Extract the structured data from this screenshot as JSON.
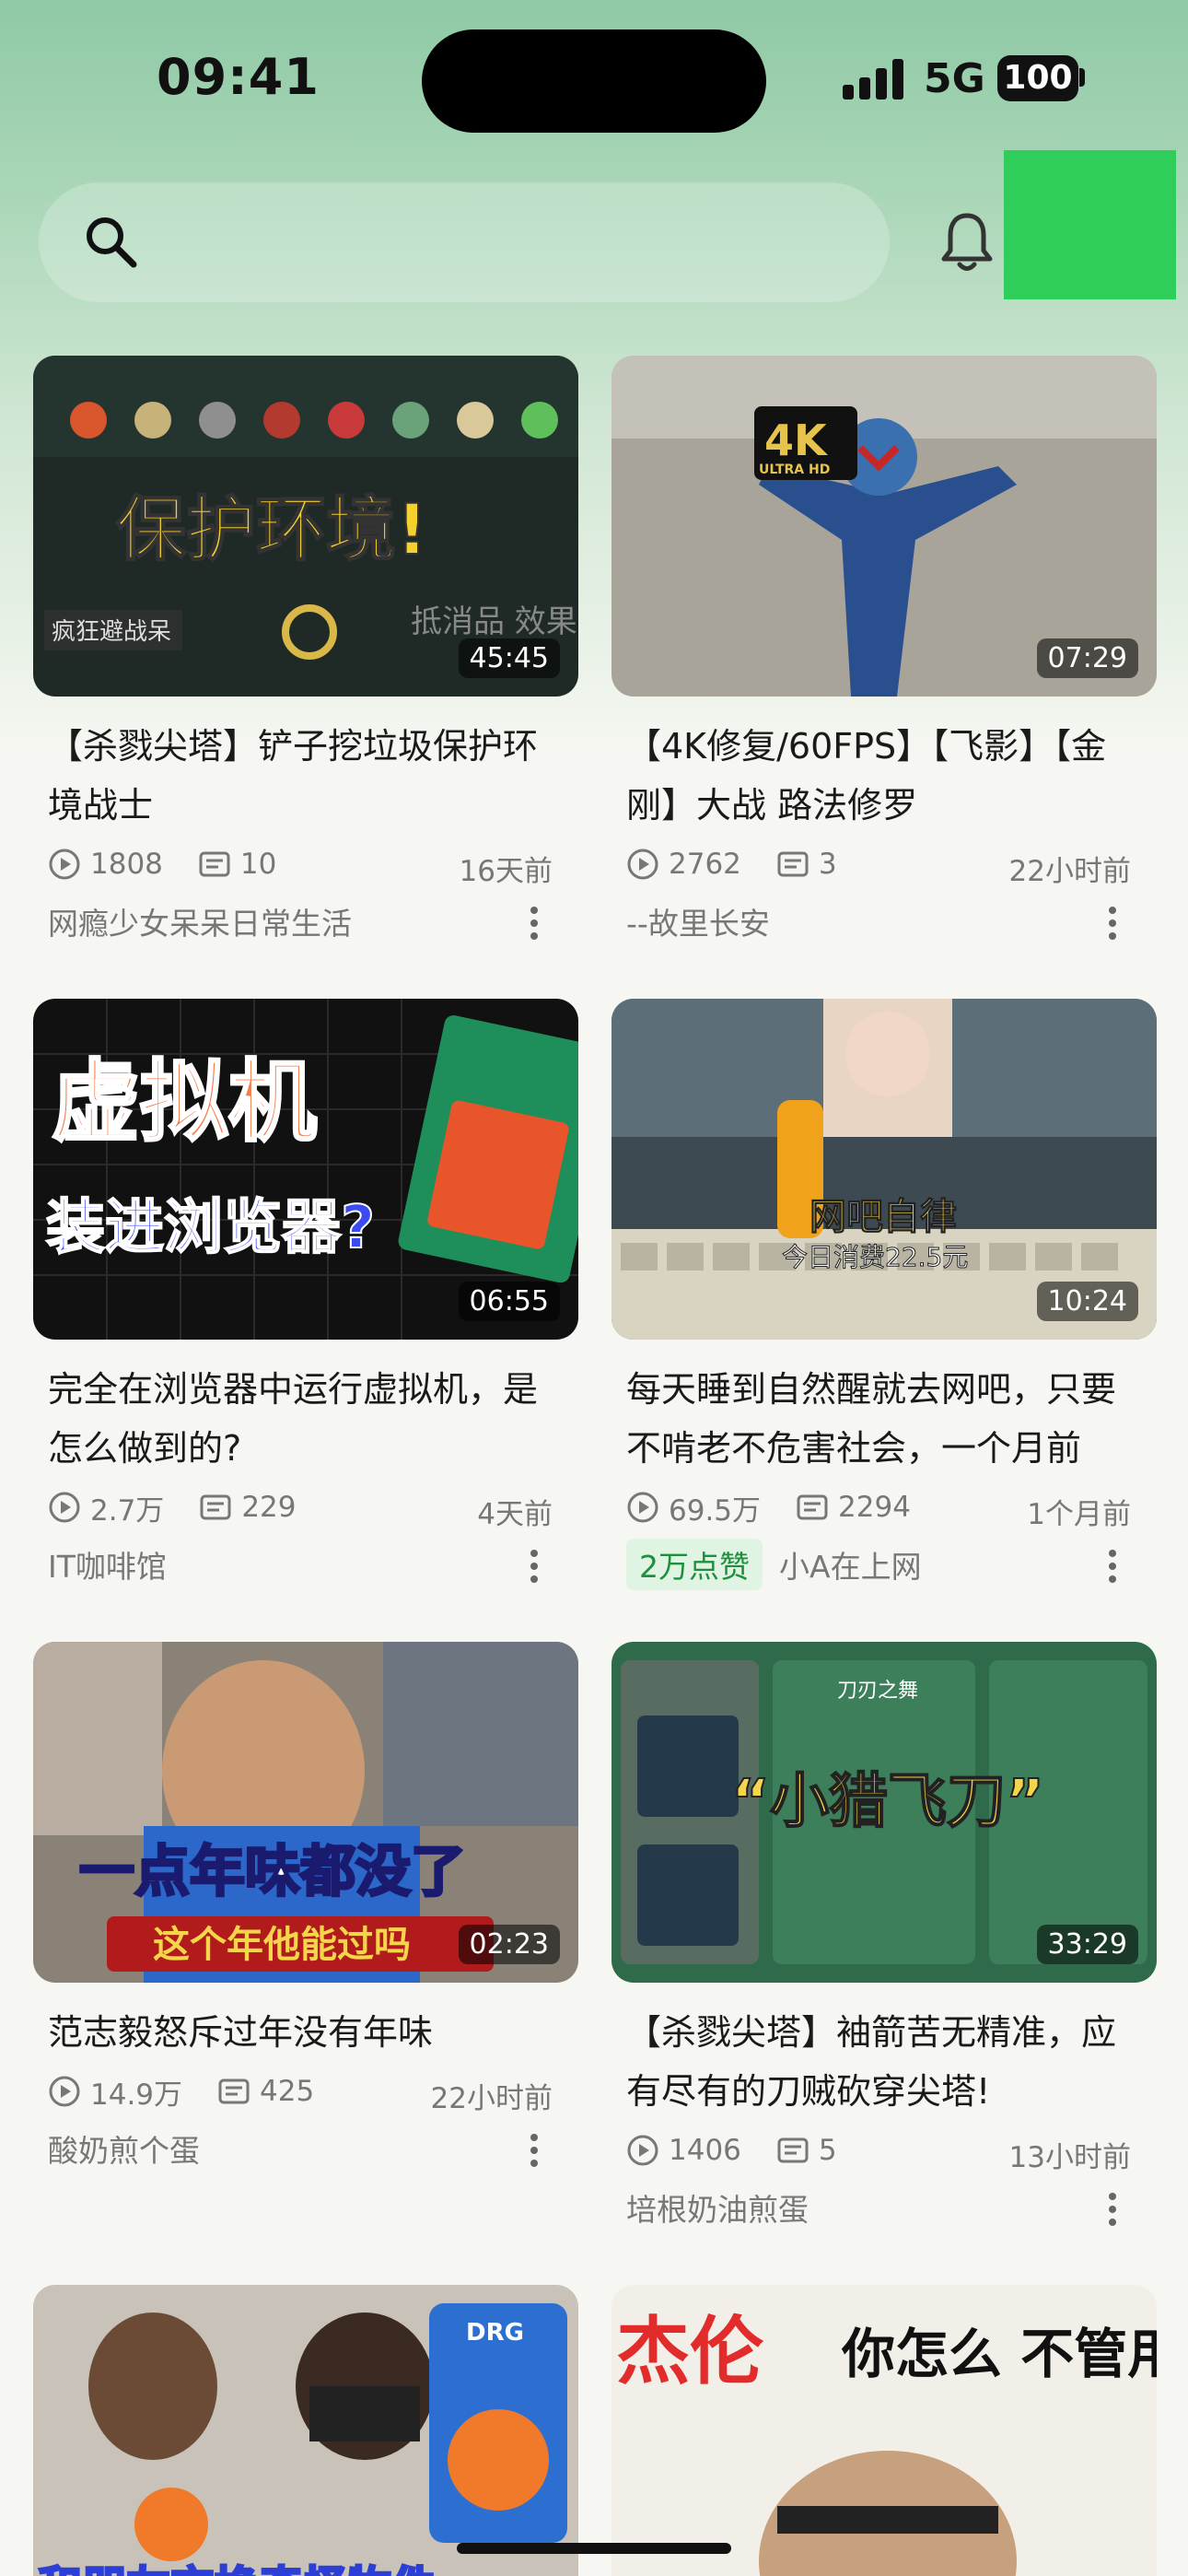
{
  "status_bar": {
    "time": "09:41",
    "network": "5G",
    "battery": "100"
  },
  "search": {
    "placeholder": ""
  },
  "colors": {
    "accent_green": "#2fce5b",
    "badge_text": "#1e8f3e"
  },
  "icons": {
    "search": "search-icon",
    "notifications": "bell-icon",
    "plays": "play-count-icon",
    "comments": "danmaku-icon",
    "more": "more-vertical-icon"
  },
  "videos": [
    {
      "thumb_text": "保护环境!",
      "thumb_sub": "疯狂避战呆",
      "thumb_sub2": "抵消品 效果结果",
      "duration": "45:45",
      "title": "【杀戮尖塔】铲子挖垃圾保护环境战士",
      "plays": "1808",
      "comments": "10",
      "time": "16天前",
      "badge": "",
      "author": "网瘾少女呆呆日常生活"
    },
    {
      "thumb_text": "4K",
      "thumb_sub": "ULTRA HD",
      "duration": "07:29",
      "title": "【4K修复/60FPS】【飞影】【金刚】大战 路法修罗",
      "plays": "2762",
      "comments": "3",
      "time": "22小时前",
      "badge": "",
      "author": "--故里长安"
    },
    {
      "thumb_text": "虚拟机",
      "thumb_sub": "装进浏览器?",
      "duration": "06:55",
      "title": "完全在浏览器中运行虚拟机，是怎么做到的?",
      "plays": "2.7万",
      "comments": "229",
      "time": "4天前",
      "badge": "",
      "author": "IT咖啡馆"
    },
    {
      "thumb_text": "网吧自律",
      "thumb_sub": "今日消费22.5元",
      "duration": "10:24",
      "title": "每天睡到自然醒就去网吧，只要不啃老不危害社会，一个月前",
      "plays": "69.5万",
      "comments": "2294",
      "time": "1个月前",
      "badge": "2万点赞",
      "author": "小A在上网"
    },
    {
      "thumb_text": "一点年味都没了",
      "thumb_sub": "这个年他能过吗",
      "duration": "02:23",
      "title": "范志毅怒斥过年没有年味",
      "plays": "14.9万",
      "comments": "425",
      "time": "22小时前",
      "badge": "",
      "author": "酸奶煎个蛋"
    },
    {
      "thumb_text": "“小猎飞刀”",
      "thumb_sub": "刀刃之舞",
      "duration": "33:29",
      "title": "【杀戮尖塔】袖箭苦无精准，应有尽有的刀贼砍穿尖塔!",
      "plays": "1406",
      "comments": "5",
      "time": "13小时前",
      "badge": "",
      "author": "培根奶油煎蛋"
    },
    {
      "thumb_text": "和朋友交换奇怪物件",
      "thumb_sub": "DRG",
      "duration": ""
    },
    {
      "thumb_text": "杰伦",
      "thumb_sub": "你怎么 不管用",
      "duration": ""
    }
  ]
}
